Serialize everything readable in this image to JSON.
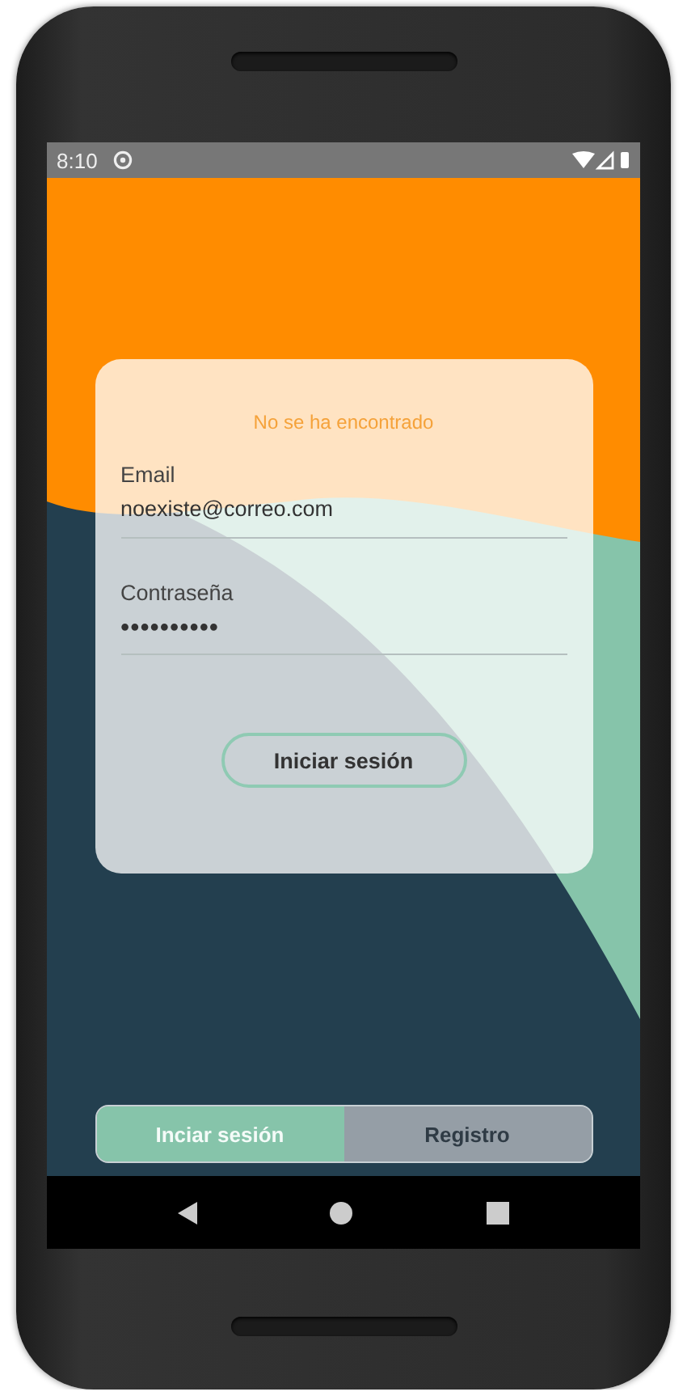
{
  "status_bar": {
    "time": "8:10"
  },
  "login_card": {
    "message": "No se ha encontrado",
    "fields": [
      {
        "kind": "text",
        "label": "Email",
        "value": "noexiste@correo.com"
      },
      {
        "kind": "password",
        "label": "Contraseña",
        "value": "••••••••••"
      }
    ],
    "button": "Iniciar sesión"
  },
  "tabs": [
    {
      "label": "Inciar sesión",
      "selected": true
    },
    {
      "label": "Registro",
      "selected": false
    }
  ]
}
